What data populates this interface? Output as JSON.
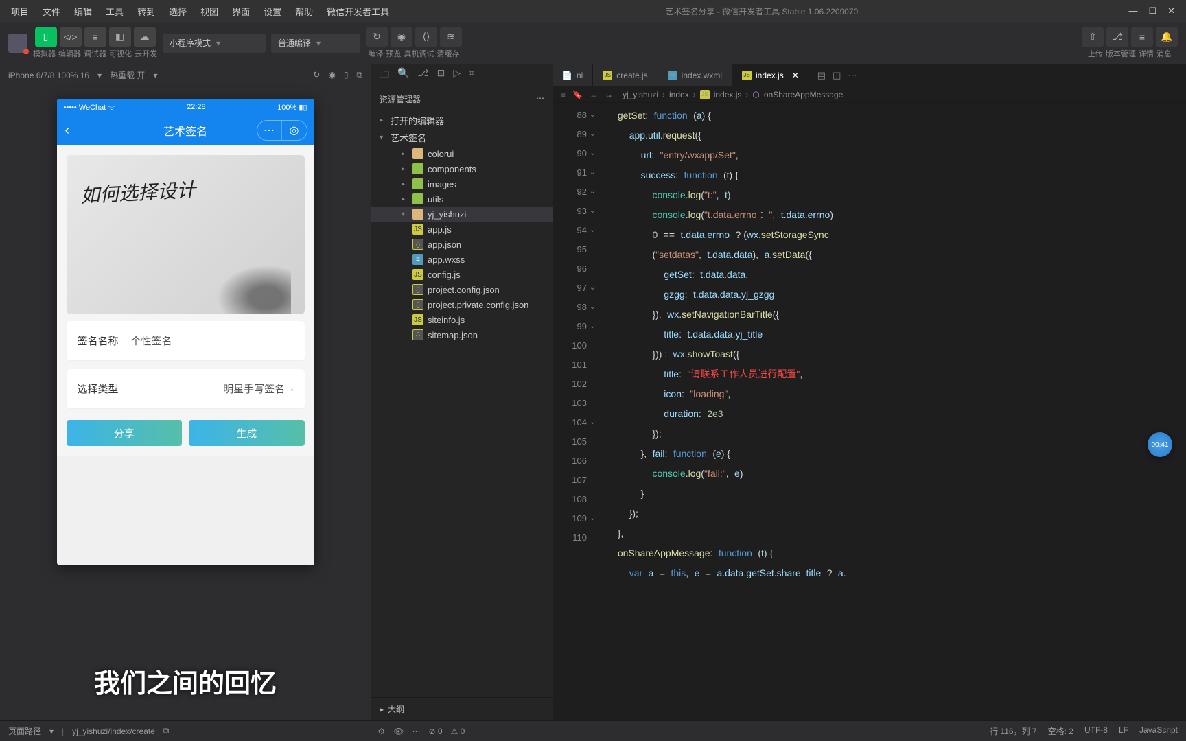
{
  "titlebar": {
    "menu": [
      "项目",
      "文件",
      "编辑",
      "工具",
      "转到",
      "选择",
      "视图",
      "界面",
      "设置",
      "帮助",
      "微信开发者工具"
    ],
    "title": "艺术签名分享 - 微信开发者工具 Stable 1.06.2209070"
  },
  "toolbar": {
    "groups": [
      {
        "label": "模拟器"
      },
      {
        "label": "编辑器"
      },
      {
        "label": "调试器"
      },
      {
        "label": "可视化"
      },
      {
        "label": "云开发"
      }
    ],
    "mode_dropdown": "小程序模式",
    "compile_dropdown": "普通编译",
    "mid_labels": [
      "编译",
      "预览",
      "真机调试",
      "清缓存"
    ],
    "right": [
      {
        "label": "上传"
      },
      {
        "label": "版本管理"
      },
      {
        "label": "详情"
      },
      {
        "label": "消息"
      }
    ]
  },
  "sim": {
    "device": "iPhone 6/7/8 100% 16",
    "reload": "热重载 开",
    "status_left": "••••• WeChat",
    "status_time": "22:28",
    "status_right": "100%",
    "nav_title": "艺术签名",
    "form_name_label": "签名名称",
    "form_name_value": "个性签名",
    "form_type_label": "选择类型",
    "form_type_value": "明星手写签名",
    "btn_share": "分享",
    "btn_generate": "生成"
  },
  "caption": "我们之间的回忆",
  "explorer": {
    "title": "资源管理器",
    "sections": [
      "打开的编辑器",
      "艺术签名"
    ],
    "tree": [
      {
        "name": "colorui",
        "type": "folder",
        "depth": 2
      },
      {
        "name": "components",
        "type": "fgreen",
        "depth": 2
      },
      {
        "name": "images",
        "type": "fgreen",
        "depth": 2
      },
      {
        "name": "utils",
        "type": "fgreen",
        "depth": 2
      },
      {
        "name": "yj_yishuzi",
        "type": "folder",
        "depth": 2,
        "selected": true,
        "open": true
      },
      {
        "name": "app.js",
        "type": "js",
        "depth": 2
      },
      {
        "name": "app.json",
        "type": "json",
        "depth": 2
      },
      {
        "name": "app.wxss",
        "type": "wxss",
        "depth": 2
      },
      {
        "name": "config.js",
        "type": "js",
        "depth": 2
      },
      {
        "name": "project.config.json",
        "type": "json",
        "depth": 2
      },
      {
        "name": "project.private.config.json",
        "type": "json",
        "depth": 2
      },
      {
        "name": "siteinfo.js",
        "type": "js",
        "depth": 2
      },
      {
        "name": "sitemap.json",
        "type": "json",
        "depth": 2
      }
    ],
    "outline": "大纲"
  },
  "editor": {
    "tabs": [
      {
        "name": "nl",
        "type": "txt",
        "active": false
      },
      {
        "name": "create.js",
        "type": "js",
        "active": false
      },
      {
        "name": "index.wxml",
        "type": "wx",
        "active": false
      },
      {
        "name": "index.js",
        "type": "js",
        "active": true
      }
    ],
    "breadcrumb": [
      "yj_yishuzi",
      "index",
      "index.js",
      "onShareAppMessage"
    ],
    "line_start": 88,
    "line_count": 23
  },
  "statusbar": {
    "page_path_label": "页面路径",
    "page_path": "yj_yishuzi/index/create",
    "errors": "⊘ 0",
    "warnings": "⚠ 0",
    "pos": "行 116，列 7",
    "spaces": "空格: 2",
    "encoding": "UTF-8",
    "eol": "LF",
    "lang": "JavaScript"
  },
  "float_badge": "00:41"
}
